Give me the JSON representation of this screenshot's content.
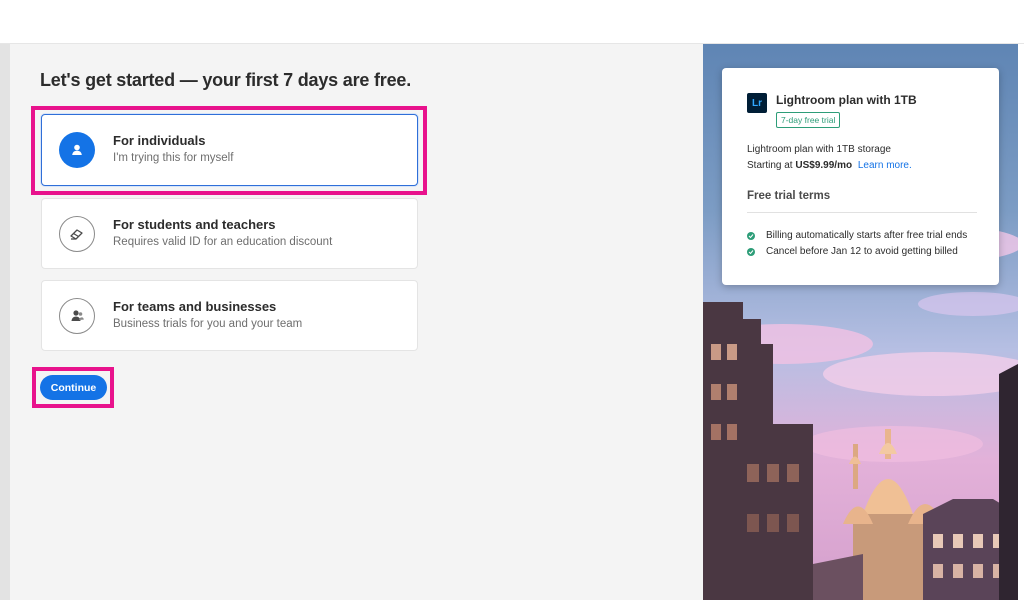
{
  "heading": "Let's get started — your first 7 days are free.",
  "options": [
    {
      "title": "For individuals",
      "subtitle": "I'm trying this for myself",
      "icon": "person-icon",
      "selected": true
    },
    {
      "title": "For students and teachers",
      "subtitle": "Requires valid ID for an education discount",
      "icon": "eraser-icon",
      "selected": false
    },
    {
      "title": "For teams and businesses",
      "subtitle": "Business trials for you and your team",
      "icon": "team-icon",
      "selected": false
    }
  ],
  "continue_label": "Continue",
  "plan": {
    "logo": "Lr",
    "title": "Lightroom plan with 1TB",
    "badge": "7-day free trial",
    "description": "Lightroom plan with 1TB storage",
    "price_prefix": "Starting at",
    "price": "US$9.99/mo",
    "learn_more": "Learn more.",
    "terms_title": "Free trial terms",
    "terms": [
      "Billing automatically starts after free trial ends",
      "Cancel before Jan 12 to avoid getting billed"
    ]
  },
  "colors": {
    "accent": "#1473e6",
    "highlight": "#e8128c",
    "success": "#2d9d78"
  }
}
